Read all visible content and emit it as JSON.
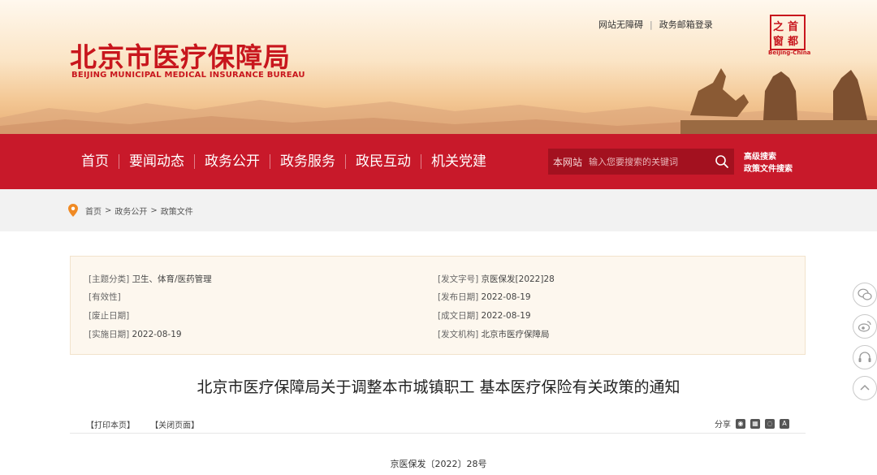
{
  "header": {
    "top_links": [
      "网站无障碍",
      "政务邮箱登录"
    ],
    "logo_cn": "北京市医疗保障局",
    "logo_en": "BEIJING MUNICIPAL MEDICAL INSURANCE BUREAU",
    "seal_chars": [
      "首",
      "都",
      "之",
      "窗"
    ],
    "seal_caption": "Beijing-China"
  },
  "nav": {
    "items": [
      "首页",
      "要闻动态",
      "政务公开",
      "政务服务",
      "政民互动",
      "机关党建"
    ]
  },
  "search": {
    "scope": "本网站",
    "placeholder": "输入您要搜索的关键词",
    "advanced": "高级搜索",
    "policy_search": "政策文件搜索"
  },
  "breadcrumb": [
    "首页",
    "政务公开",
    "政策文件"
  ],
  "info": {
    "left": [
      {
        "k": "[主题分类]",
        "v": "卫生、体育/医药管理"
      },
      {
        "k": "[有效性]",
        "v": ""
      },
      {
        "k": "[废止日期]",
        "v": ""
      },
      {
        "k": "[实施日期]",
        "v": "2022-08-19"
      }
    ],
    "right": [
      {
        "k": "[发文字号]",
        "v": "京医保发[2022]28"
      },
      {
        "k": "[发布日期]",
        "v": "2022-08-19"
      },
      {
        "k": "[成文日期]",
        "v": "2022-08-19"
      },
      {
        "k": "[发文机构]",
        "v": "北京市医疗保障局"
      }
    ]
  },
  "doc": {
    "title": "北京市医疗保障局关于调整本市城镇职工 基本医疗保险有关政策的通知",
    "print": "【打印本页】",
    "close": "【关闭页面】",
    "share_label": "分享",
    "number": "京医保发〔2022〕28号"
  },
  "colors": {
    "brand_red": "#c8192a",
    "search_bg": "#a3111f",
    "info_bg": "#fdf7ee"
  }
}
